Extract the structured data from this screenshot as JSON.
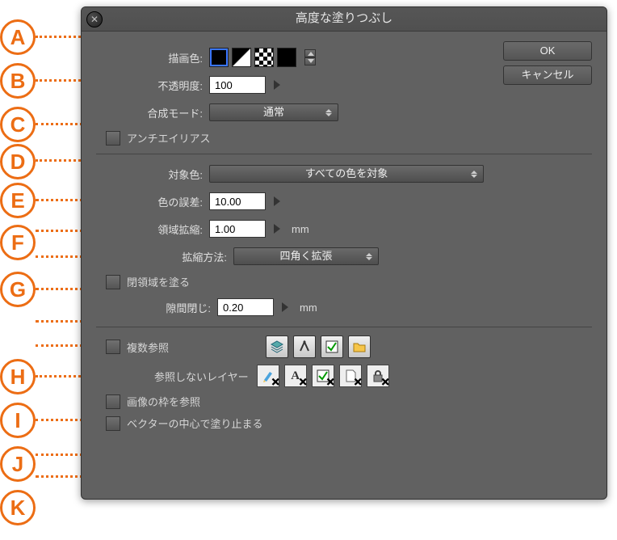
{
  "annotations": [
    "A",
    "B",
    "C",
    "D",
    "E",
    "F",
    "G",
    "H",
    "I",
    "J",
    "K"
  ],
  "dialog": {
    "title": "高度な塗りつぶし",
    "ok": "OK",
    "cancel": "キャンセル",
    "draw_color_label": "描画色:",
    "opacity_label": "不透明度:",
    "opacity_value": "100",
    "blend_label": "合成モード:",
    "blend_value": "通常",
    "antialias_label": "アンチエイリアス",
    "target_color_label": "対象色:",
    "target_color_value": "すべての色を対象",
    "tolerance_label": "色の誤差:",
    "tolerance_value": "10.00",
    "expand_label": "領域拡縮:",
    "expand_value": "1.00",
    "expand_unit": "mm",
    "expand_method_label": "拡縮方法:",
    "expand_method_value": "四角く拡張",
    "fill_enclosed_label": "閉領域を塗る",
    "gap_close_label": "隙間閉じ:",
    "gap_close_value": "0.20",
    "gap_close_unit": "mm",
    "multi_ref_label": "複数参照",
    "exclude_layers_label": "参照しないレイヤー",
    "frame_ref_label": "画像の枠を参照",
    "vector_center_label": "ベクターの中心で塗り止まる"
  }
}
